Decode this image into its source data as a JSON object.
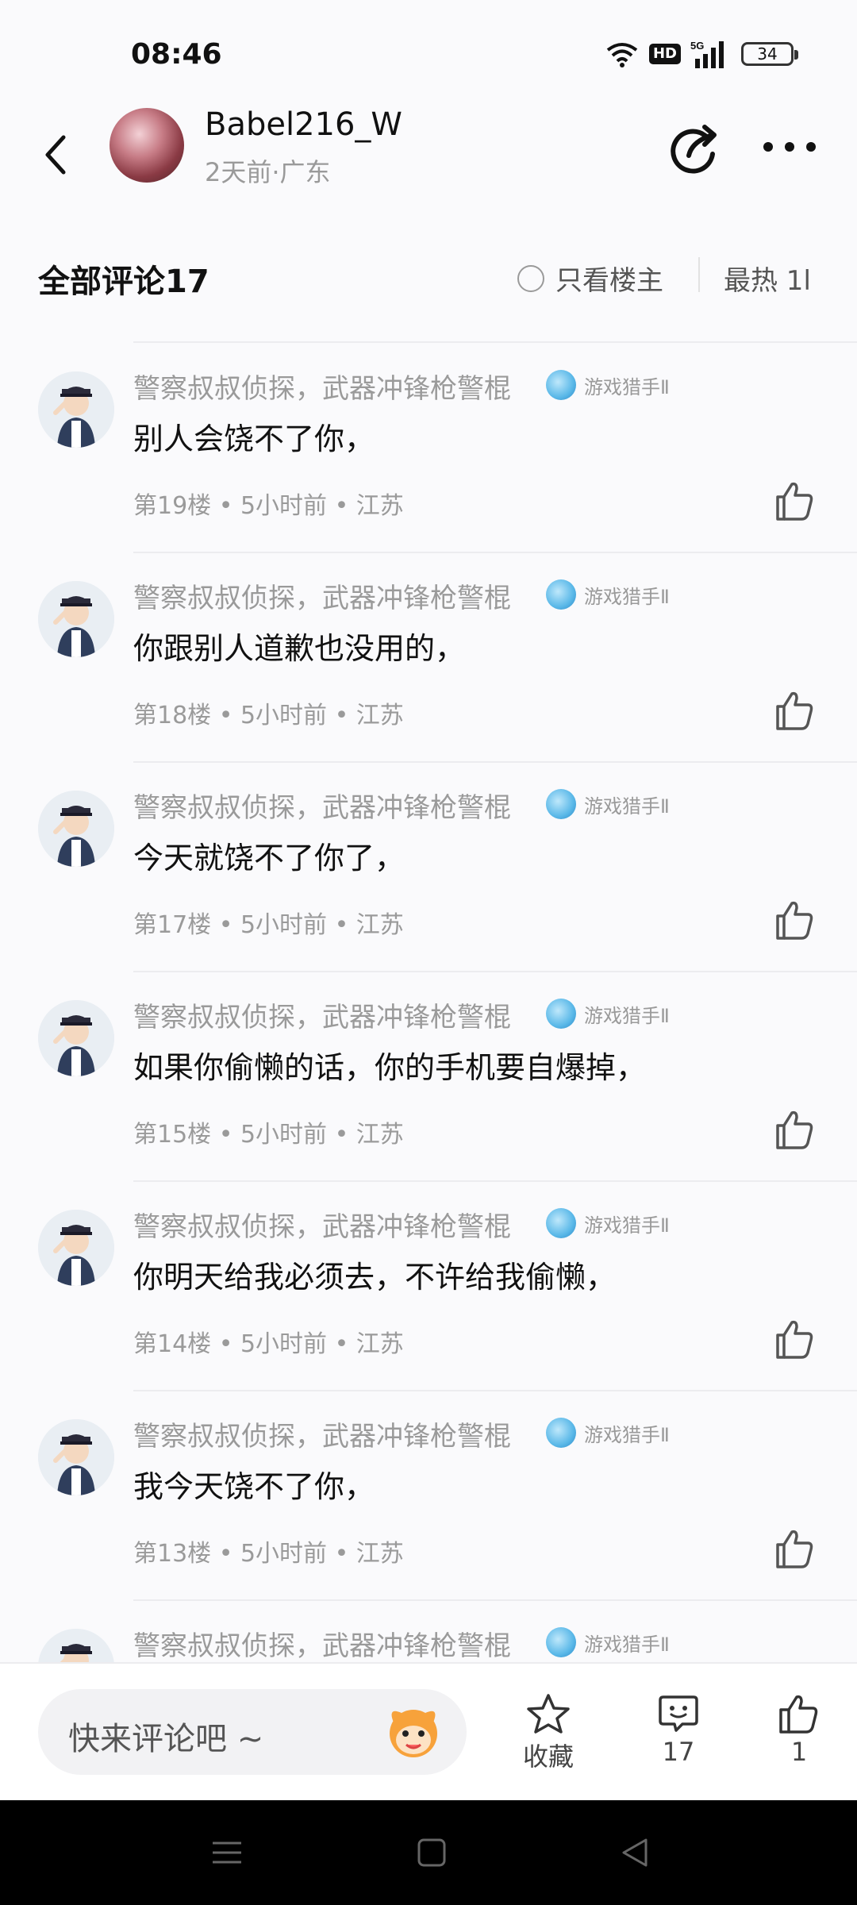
{
  "status": {
    "time": "08:46",
    "hd": "HD",
    "network": "5G",
    "battery": "34"
  },
  "header": {
    "username": "Babel216_W",
    "meta": "2天前·广东",
    "icons": [
      "back-icon",
      "share-icon",
      "more-icon"
    ]
  },
  "comments_header": {
    "title": "全部评论17",
    "only_owner": "只看楼主",
    "sort": "最热 1l"
  },
  "comments": [
    {
      "name": "警察叔叔侦探，武器冲锋枪警棍",
      "badge": "游戏猎手Ⅱ",
      "text": "别人会饶不了你，",
      "meta": "第19楼 • 5小时前 • 江苏"
    },
    {
      "name": "警察叔叔侦探，武器冲锋枪警棍",
      "badge": "游戏猎手Ⅱ",
      "text": "你跟别人道歉也没用的，",
      "meta": "第18楼 • 5小时前 • 江苏"
    },
    {
      "name": "警察叔叔侦探，武器冲锋枪警棍",
      "badge": "游戏猎手Ⅱ",
      "text": "今天就饶不了你了，",
      "meta": "第17楼 • 5小时前 • 江苏"
    },
    {
      "name": "警察叔叔侦探，武器冲锋枪警棍",
      "badge": "游戏猎手Ⅱ",
      "text": "如果你偷懒的话，你的手机要自爆掉，",
      "meta": "第15楼 • 5小时前 • 江苏"
    },
    {
      "name": "警察叔叔侦探，武器冲锋枪警棍",
      "badge": "游戏猎手Ⅱ",
      "text": "你明天给我必须去，不许给我偷懒，",
      "meta": "第14楼 • 5小时前 • 江苏"
    },
    {
      "name": "警察叔叔侦探，武器冲锋枪警棍",
      "badge": "游戏猎手Ⅱ",
      "text": "我今天饶不了你，",
      "meta": "第13楼 • 5小时前 • 江苏"
    },
    {
      "name": "警察叔叔侦探，武器冲锋枪警棍",
      "badge": "游戏猎手Ⅱ",
      "text": "",
      "meta": ""
    }
  ],
  "bottom": {
    "placeholder": "快来评论吧 ~",
    "favorite": "收藏",
    "comment_count": "17",
    "like_count": "1"
  },
  "colors": {
    "text_primary": "#111111",
    "text_secondary": "#9a9a9a",
    "badge_blue": "#5ab8e8",
    "background": "#fafafc"
  }
}
